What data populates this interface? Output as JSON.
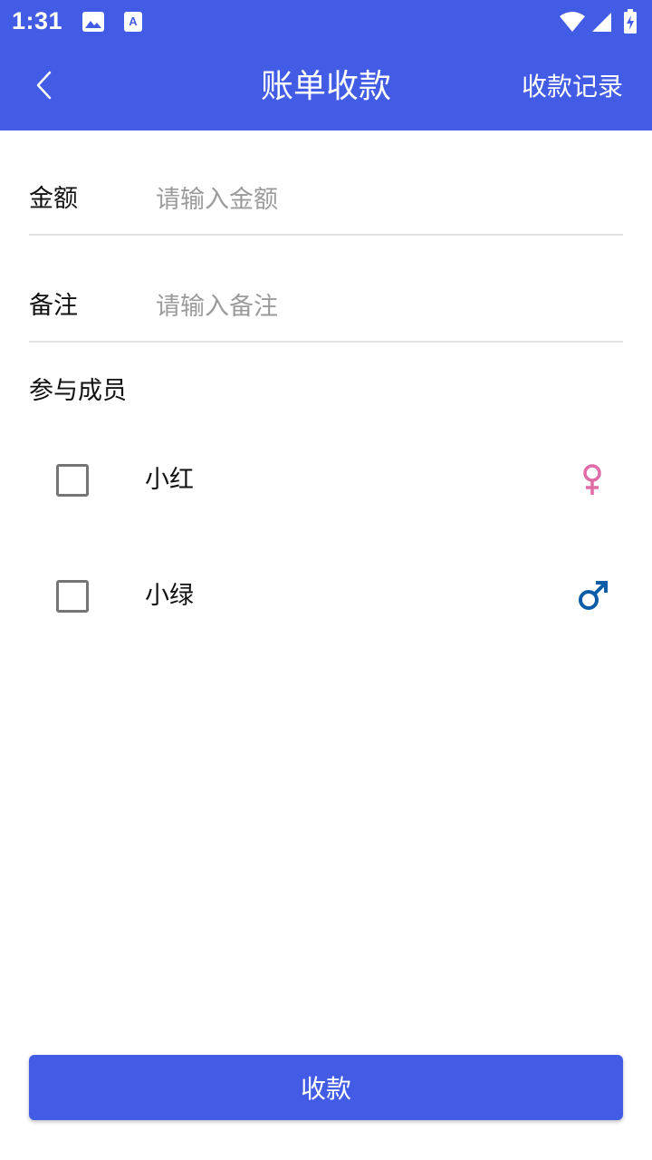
{
  "status_bar": {
    "time": "1:31",
    "icons": [
      "image-icon",
      "a-icon",
      "wifi-icon",
      "signal-icon",
      "battery-charging-icon"
    ]
  },
  "toolbar": {
    "title": "账单收款",
    "back_icon": "chevron-left-icon",
    "records_label": "收款记录"
  },
  "form": {
    "amount": {
      "label": "金额",
      "placeholder": "请输入金额",
      "value": ""
    },
    "remark": {
      "label": "备注",
      "placeholder": "请输入备注",
      "value": ""
    }
  },
  "members": {
    "title": "参与成员",
    "items": [
      {
        "name": "小红",
        "gender": "female",
        "gender_icon": "female-symbol-icon",
        "color": "#E06BA6",
        "checked": false
      },
      {
        "name": "小绿",
        "gender": "male",
        "gender_icon": "male-symbol-icon",
        "color": "#0D5CA8",
        "checked": false
      }
    ]
  },
  "submit_label": "收款",
  "colors": {
    "primary": "#425CE6",
    "female": "#E06BA6",
    "male": "#0D5CA8"
  }
}
